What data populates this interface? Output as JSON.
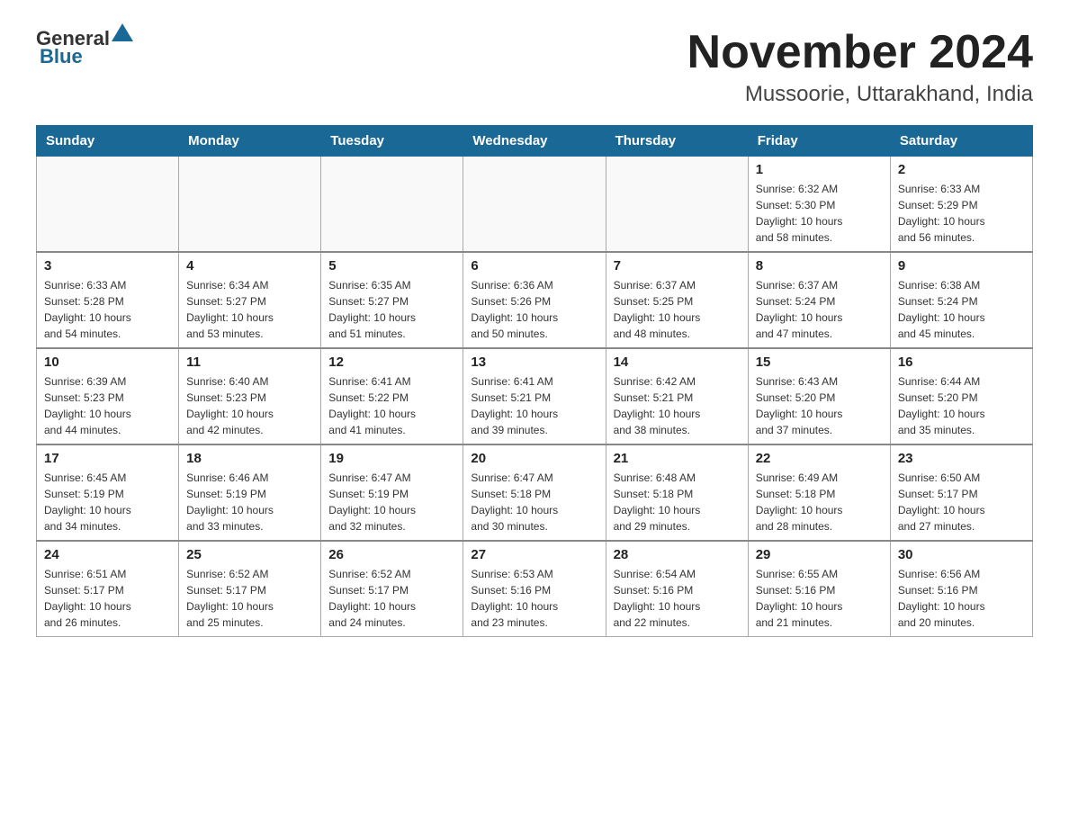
{
  "logo": {
    "general": "General",
    "blue": "Blue"
  },
  "title": "November 2024",
  "location": "Mussoorie, Uttarakhand, India",
  "days_of_week": [
    "Sunday",
    "Monday",
    "Tuesday",
    "Wednesday",
    "Thursday",
    "Friday",
    "Saturday"
  ],
  "weeks": [
    [
      {
        "day": "",
        "info": ""
      },
      {
        "day": "",
        "info": ""
      },
      {
        "day": "",
        "info": ""
      },
      {
        "day": "",
        "info": ""
      },
      {
        "day": "",
        "info": ""
      },
      {
        "day": "1",
        "info": "Sunrise: 6:32 AM\nSunset: 5:30 PM\nDaylight: 10 hours\nand 58 minutes."
      },
      {
        "day": "2",
        "info": "Sunrise: 6:33 AM\nSunset: 5:29 PM\nDaylight: 10 hours\nand 56 minutes."
      }
    ],
    [
      {
        "day": "3",
        "info": "Sunrise: 6:33 AM\nSunset: 5:28 PM\nDaylight: 10 hours\nand 54 minutes."
      },
      {
        "day": "4",
        "info": "Sunrise: 6:34 AM\nSunset: 5:27 PM\nDaylight: 10 hours\nand 53 minutes."
      },
      {
        "day": "5",
        "info": "Sunrise: 6:35 AM\nSunset: 5:27 PM\nDaylight: 10 hours\nand 51 minutes."
      },
      {
        "day": "6",
        "info": "Sunrise: 6:36 AM\nSunset: 5:26 PM\nDaylight: 10 hours\nand 50 minutes."
      },
      {
        "day": "7",
        "info": "Sunrise: 6:37 AM\nSunset: 5:25 PM\nDaylight: 10 hours\nand 48 minutes."
      },
      {
        "day": "8",
        "info": "Sunrise: 6:37 AM\nSunset: 5:24 PM\nDaylight: 10 hours\nand 47 minutes."
      },
      {
        "day": "9",
        "info": "Sunrise: 6:38 AM\nSunset: 5:24 PM\nDaylight: 10 hours\nand 45 minutes."
      }
    ],
    [
      {
        "day": "10",
        "info": "Sunrise: 6:39 AM\nSunset: 5:23 PM\nDaylight: 10 hours\nand 44 minutes."
      },
      {
        "day": "11",
        "info": "Sunrise: 6:40 AM\nSunset: 5:23 PM\nDaylight: 10 hours\nand 42 minutes."
      },
      {
        "day": "12",
        "info": "Sunrise: 6:41 AM\nSunset: 5:22 PM\nDaylight: 10 hours\nand 41 minutes."
      },
      {
        "day": "13",
        "info": "Sunrise: 6:41 AM\nSunset: 5:21 PM\nDaylight: 10 hours\nand 39 minutes."
      },
      {
        "day": "14",
        "info": "Sunrise: 6:42 AM\nSunset: 5:21 PM\nDaylight: 10 hours\nand 38 minutes."
      },
      {
        "day": "15",
        "info": "Sunrise: 6:43 AM\nSunset: 5:20 PM\nDaylight: 10 hours\nand 37 minutes."
      },
      {
        "day": "16",
        "info": "Sunrise: 6:44 AM\nSunset: 5:20 PM\nDaylight: 10 hours\nand 35 minutes."
      }
    ],
    [
      {
        "day": "17",
        "info": "Sunrise: 6:45 AM\nSunset: 5:19 PM\nDaylight: 10 hours\nand 34 minutes."
      },
      {
        "day": "18",
        "info": "Sunrise: 6:46 AM\nSunset: 5:19 PM\nDaylight: 10 hours\nand 33 minutes."
      },
      {
        "day": "19",
        "info": "Sunrise: 6:47 AM\nSunset: 5:19 PM\nDaylight: 10 hours\nand 32 minutes."
      },
      {
        "day": "20",
        "info": "Sunrise: 6:47 AM\nSunset: 5:18 PM\nDaylight: 10 hours\nand 30 minutes."
      },
      {
        "day": "21",
        "info": "Sunrise: 6:48 AM\nSunset: 5:18 PM\nDaylight: 10 hours\nand 29 minutes."
      },
      {
        "day": "22",
        "info": "Sunrise: 6:49 AM\nSunset: 5:18 PM\nDaylight: 10 hours\nand 28 minutes."
      },
      {
        "day": "23",
        "info": "Sunrise: 6:50 AM\nSunset: 5:17 PM\nDaylight: 10 hours\nand 27 minutes."
      }
    ],
    [
      {
        "day": "24",
        "info": "Sunrise: 6:51 AM\nSunset: 5:17 PM\nDaylight: 10 hours\nand 26 minutes."
      },
      {
        "day": "25",
        "info": "Sunrise: 6:52 AM\nSunset: 5:17 PM\nDaylight: 10 hours\nand 25 minutes."
      },
      {
        "day": "26",
        "info": "Sunrise: 6:52 AM\nSunset: 5:17 PM\nDaylight: 10 hours\nand 24 minutes."
      },
      {
        "day": "27",
        "info": "Sunrise: 6:53 AM\nSunset: 5:16 PM\nDaylight: 10 hours\nand 23 minutes."
      },
      {
        "day": "28",
        "info": "Sunrise: 6:54 AM\nSunset: 5:16 PM\nDaylight: 10 hours\nand 22 minutes."
      },
      {
        "day": "29",
        "info": "Sunrise: 6:55 AM\nSunset: 5:16 PM\nDaylight: 10 hours\nand 21 minutes."
      },
      {
        "day": "30",
        "info": "Sunrise: 6:56 AM\nSunset: 5:16 PM\nDaylight: 10 hours\nand 20 minutes."
      }
    ]
  ]
}
